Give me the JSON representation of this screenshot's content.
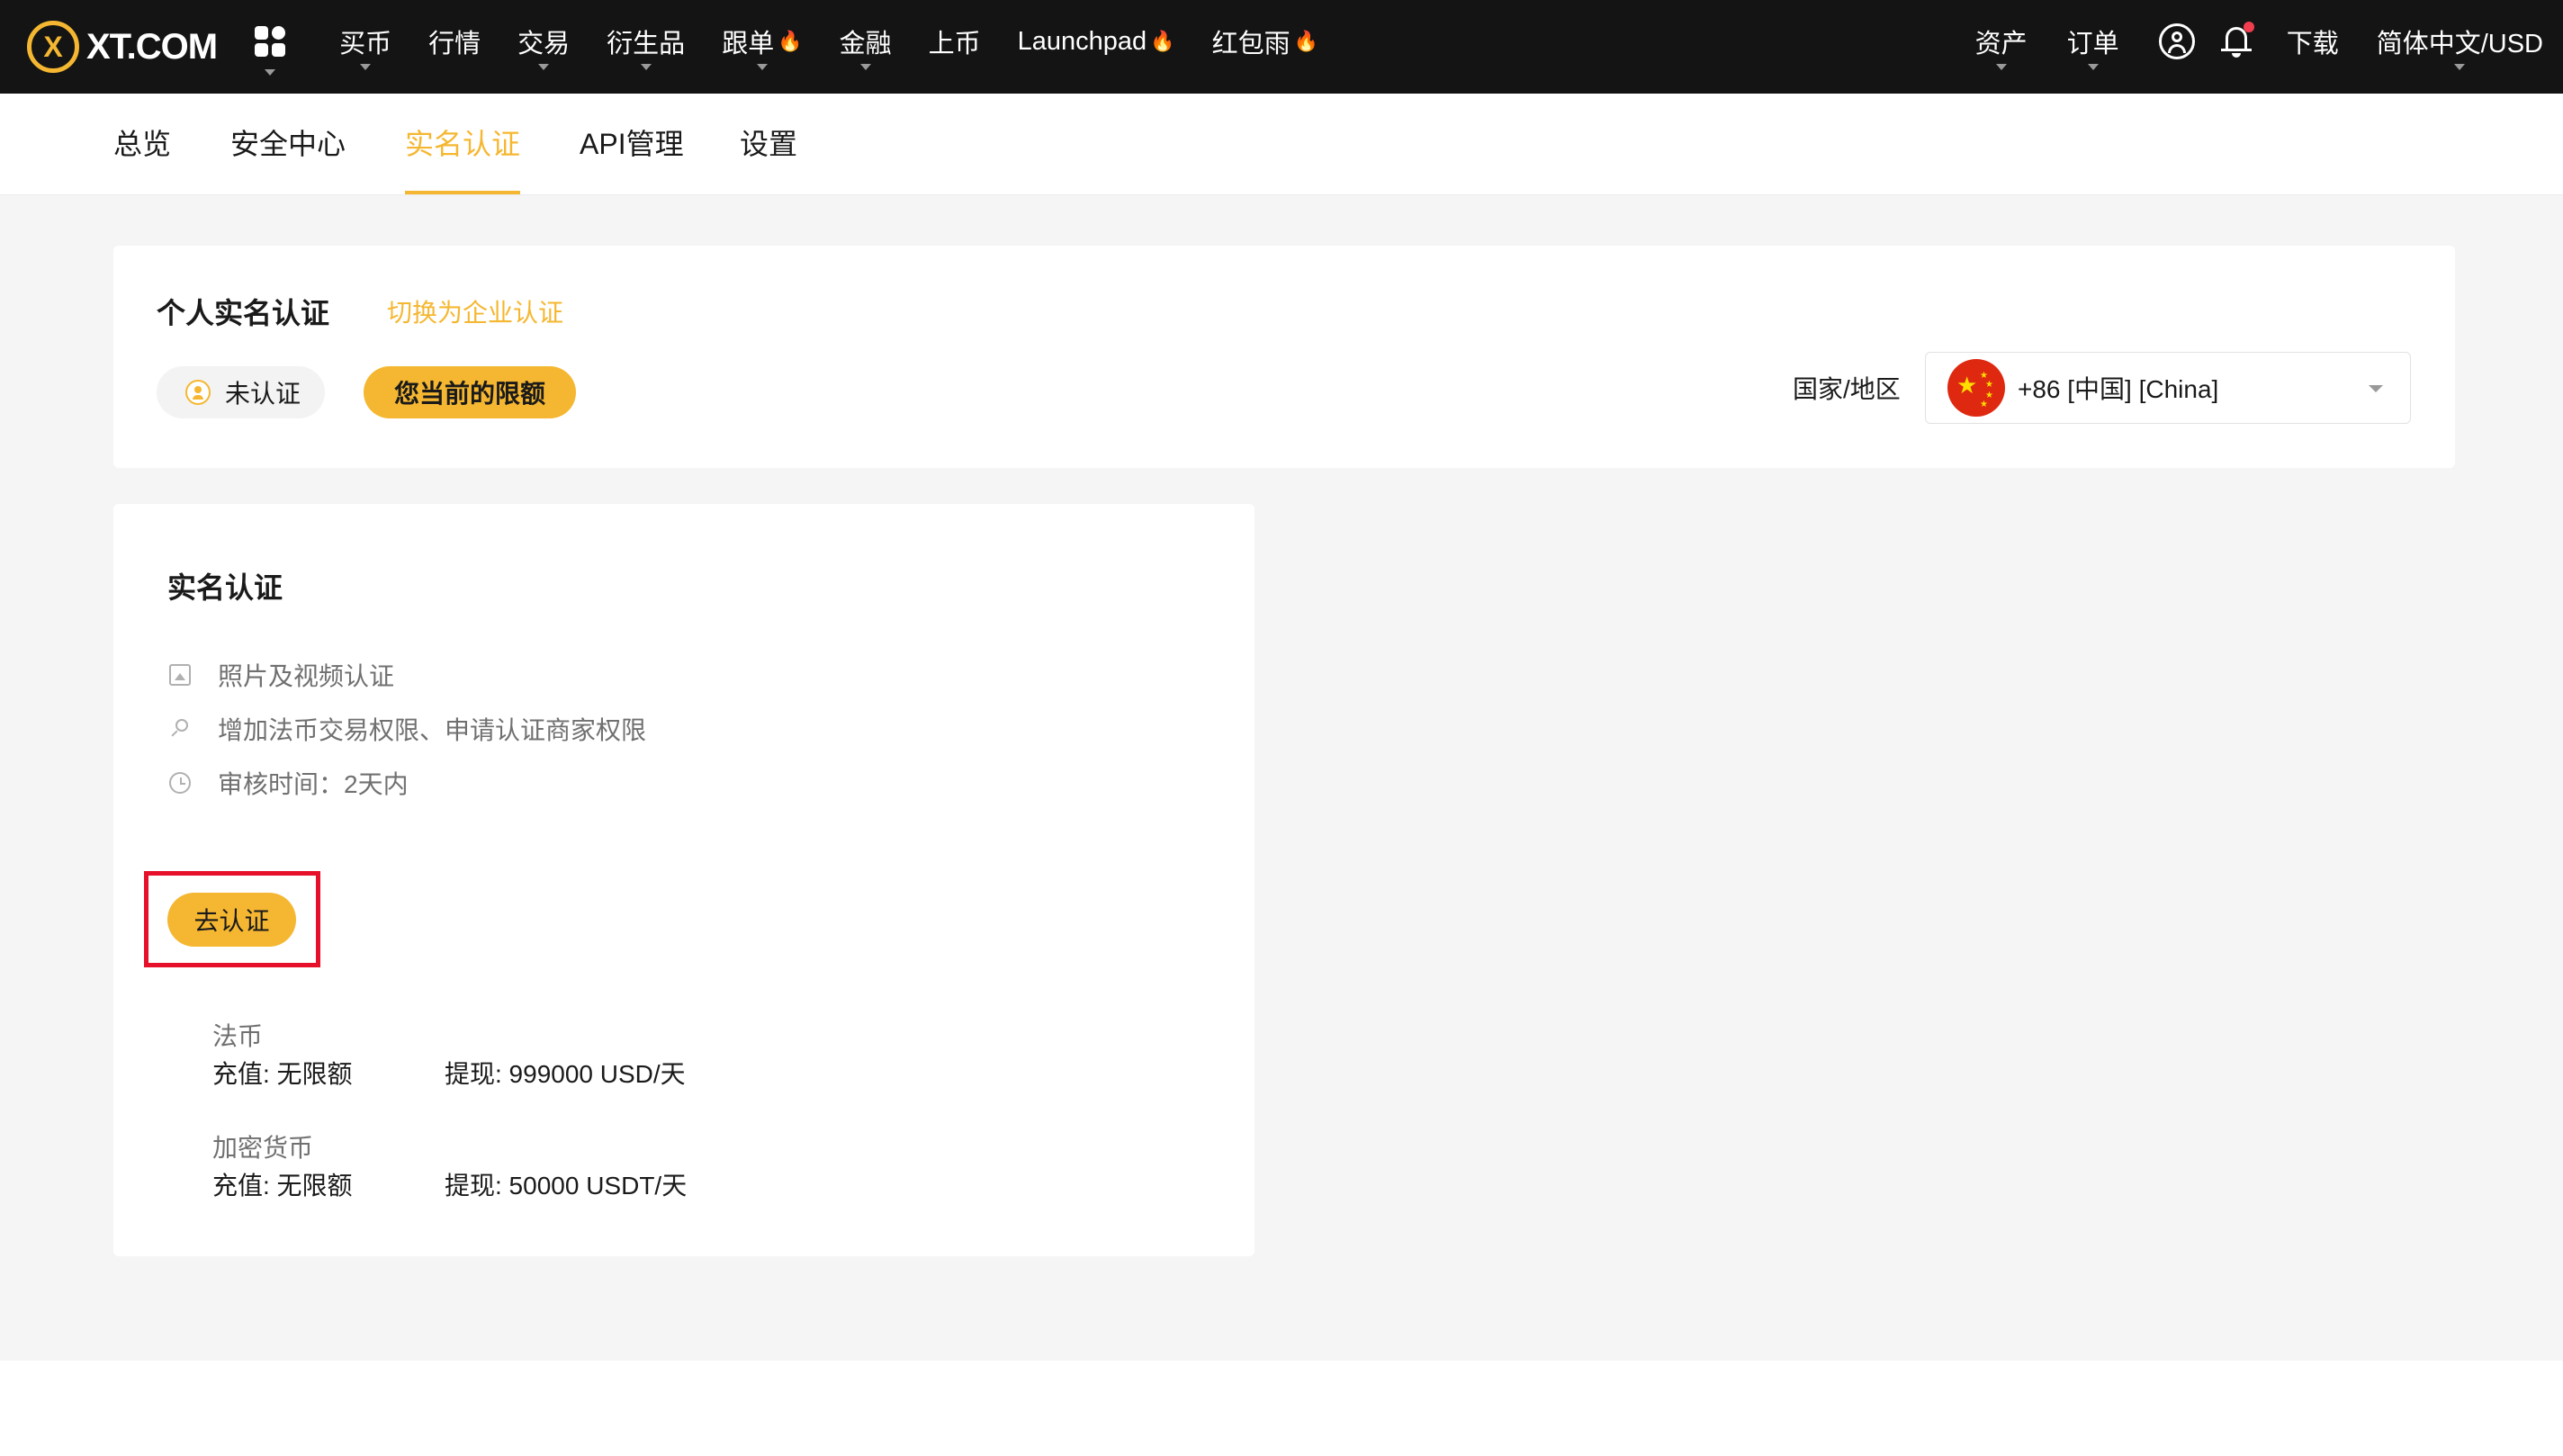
{
  "brand": {
    "logo_mark": "X",
    "logo_text": "XT.COM",
    "accent_color": "#f5b731"
  },
  "topnav": {
    "apps_icon": "apps-grid-icon",
    "items": [
      {
        "label": "买币",
        "dropdown": true,
        "hot": false
      },
      {
        "label": "行情",
        "dropdown": false,
        "hot": false
      },
      {
        "label": "交易",
        "dropdown": true,
        "hot": false
      },
      {
        "label": "衍生品",
        "dropdown": true,
        "hot": false
      },
      {
        "label": "跟单",
        "dropdown": true,
        "hot": true
      },
      {
        "label": "金融",
        "dropdown": true,
        "hot": false
      },
      {
        "label": "上币",
        "dropdown": false,
        "hot": false
      },
      {
        "label": "Launchpad",
        "dropdown": false,
        "hot": true
      },
      {
        "label": "红包雨",
        "dropdown": false,
        "hot": true
      }
    ],
    "right": {
      "assets": "资产",
      "orders": "订单",
      "user_icon": "user-circle-icon",
      "bell_icon": "bell-icon",
      "download": "下载",
      "lang": "简体中文/USD"
    }
  },
  "subnav": {
    "tabs": [
      {
        "label": "总览",
        "active": false
      },
      {
        "label": "安全中心",
        "active": false
      },
      {
        "label": "实名认证",
        "active": true
      },
      {
        "label": "API管理",
        "active": false
      },
      {
        "label": "设置",
        "active": false
      }
    ]
  },
  "kyc_header": {
    "title": "个人实名认证",
    "switch_link": "切换为企业认证",
    "status_badge": "未认证",
    "limit_button": "您当前的限额",
    "country_label": "国家/地区",
    "country_value": "+86 [中国] [China]"
  },
  "kyc_card": {
    "title": "实名认证",
    "features": [
      {
        "icon": "image-icon",
        "text": "照片及视频认证"
      },
      {
        "icon": "search-icon",
        "text": "增加法币交易权限、申请认证商家权限"
      },
      {
        "icon": "clock-icon",
        "text": "审核时间：2天内"
      }
    ],
    "verify_button": "去认证",
    "limits": [
      {
        "category": "法币",
        "deposit": "充值: 无限额",
        "withdraw": "提现: 999000 USD/天"
      },
      {
        "category": "加密货币",
        "deposit": "充值: 无限额",
        "withdraw": "提现: 50000 USDT/天"
      }
    ]
  }
}
